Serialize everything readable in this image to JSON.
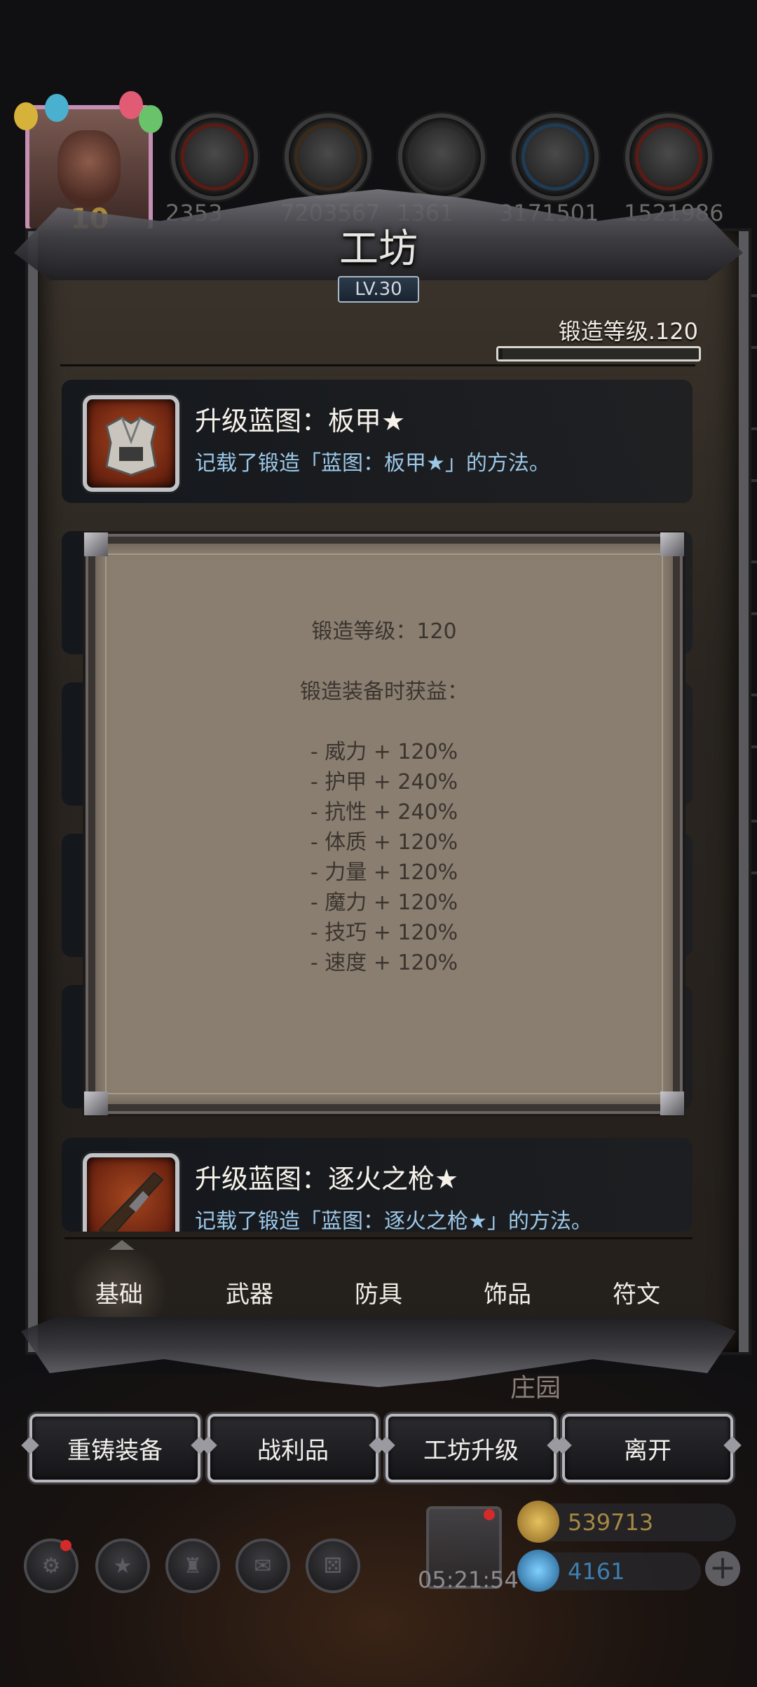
{
  "top_bar": {
    "resources": [
      {
        "icon": "meat-icon",
        "value": "2353"
      },
      {
        "icon": "wood-icon",
        "value": "7203567"
      },
      {
        "icon": "iron-icon",
        "value": "1361"
      },
      {
        "icon": "crystal-icon",
        "value": "3171501"
      },
      {
        "icon": "stone-icon",
        "value": "1521986"
      }
    ],
    "player_level": "10"
  },
  "workshop": {
    "title": "工坊",
    "level": "LV.30",
    "forge_level_label": "锻造等级.120",
    "forge_progress": 0.02
  },
  "items": [
    {
      "title": "升级蓝图：板甲★",
      "desc": "记载了锻造「蓝图：板甲★」的方法。",
      "icon": "plate-armor-icon"
    },
    {
      "title": "升级蓝图：逐火之枪★",
      "desc": "记载了锻造「蓝图：逐火之枪★」的方法。",
      "icon": "musket-icon"
    }
  ],
  "popup": {
    "line1": "锻造等级：120",
    "line2": "锻造装备时获益：",
    "bonuses": [
      "- 威力 + 120%",
      "- 护甲 + 240%",
      "- 抗性 + 240%",
      "- 体质 + 120%",
      "- 力量 + 120%",
      "- 魔力 + 120%",
      "- 技巧 + 120%",
      "- 速度 + 120%"
    ]
  },
  "tabs": [
    "基础",
    "武器",
    "防具",
    "饰品",
    "符文"
  ],
  "selected_tab": "基础",
  "buttons": {
    "reforge": "重铸装备",
    "loot": "战利品",
    "upgrade": "工坊升级",
    "leave": "离开"
  },
  "background_text": "庄园",
  "hud": {
    "timer": "05:21:54",
    "gold": "539713",
    "gems": "4161",
    "plus": "+"
  },
  "colors": {
    "accent_desc": "#9cc8e8",
    "popup_bg": "#8a7e70",
    "gold": "#c8a040",
    "gem": "#4aa6e0"
  }
}
